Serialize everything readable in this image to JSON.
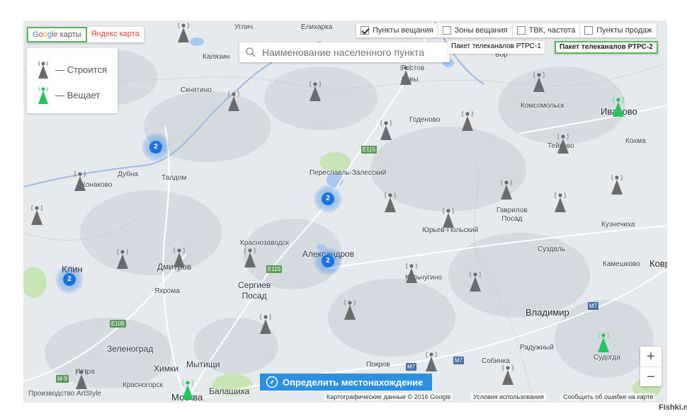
{
  "provider": {
    "google_prefix": [
      "G",
      "o",
      "o",
      "g",
      "l",
      "e"
    ],
    "google_suffix": " карты",
    "yandex": "Яндекс карта"
  },
  "legend": {
    "building": "— Строится",
    "broadcasting": "— Вещает"
  },
  "search": {
    "placeholder": "Наименование населенного пункта"
  },
  "toggles": [
    {
      "label": "Пункты вещания",
      "checked": true
    },
    {
      "label": "Зоны вещания",
      "checked": false
    },
    {
      "label": "ТВК, частота",
      "checked": false
    },
    {
      "label": "Пункты продаж",
      "checked": false
    }
  ],
  "packages": {
    "p1": "Пакет телеканалов РТРС-1",
    "p2": "Пакет телеканалов РТРС-2"
  },
  "locate_button": "Определить местонахождение",
  "zoom": {
    "in": "+",
    "out": "−"
  },
  "footer": {
    "credit": "Производство ArtStyle",
    "map_data": "Картографические данные © 2016 Google",
    "terms": "Условия использования",
    "report": "Сообщить об ошибке на карте"
  },
  "watermark": "Fishki.net",
  "colors": {
    "building": "#6b6b6b",
    "broadcasting": "#22c55e",
    "cluster": "#1d72df",
    "accent": "#2d8fe0"
  },
  "places": [
    {
      "name": "Калязин",
      "cls": ""
    },
    {
      "name": "Елихарка",
      "cls": ""
    },
    {
      "name": "Углич",
      "cls": ""
    },
    {
      "name": "Ростов",
      "cls": ""
    },
    {
      "name": "Лавы",
      "cls": ""
    },
    {
      "name": "Скнятино",
      "cls": ""
    },
    {
      "name": "Комсомольск",
      "cls": ""
    },
    {
      "name": "Иваново",
      "cls": "big"
    },
    {
      "name": "Годеново",
      "cls": ""
    },
    {
      "name": "Тейково",
      "cls": ""
    },
    {
      "name": "Кохма",
      "cls": ""
    },
    {
      "name": "Дубна",
      "cls": ""
    },
    {
      "name": "Талдом",
      "cls": ""
    },
    {
      "name": "Конаково",
      "cls": ""
    },
    {
      "name": "Переславль-Залесский",
      "cls": ""
    },
    {
      "name": "Гаврилов Посад",
      "cls": ""
    },
    {
      "name": "Юрьев-Польский",
      "cls": ""
    },
    {
      "name": "Кузнечиха",
      "cls": ""
    },
    {
      "name": "Краснозаводск",
      "cls": ""
    },
    {
      "name": "Александров",
      "cls": "med"
    },
    {
      "name": "Суздаль",
      "cls": ""
    },
    {
      "name": "Клин",
      "cls": "big"
    },
    {
      "name": "Дмитров",
      "cls": "med"
    },
    {
      "name": "Кольчугино",
      "cls": ""
    },
    {
      "name": "Камешково",
      "cls": ""
    },
    {
      "name": "Ковр",
      "cls": "big"
    },
    {
      "name": "Сергиев Посад",
      "cls": "med"
    },
    {
      "name": "Яхрома",
      "cls": ""
    },
    {
      "name": "Владимир",
      "cls": "big"
    },
    {
      "name": "Зеленоград",
      "cls": "med"
    },
    {
      "name": "Радужный",
      "cls": ""
    },
    {
      "name": "Химки",
      "cls": "med"
    },
    {
      "name": "Мытищи",
      "cls": "med"
    },
    {
      "name": "Истра",
      "cls": ""
    },
    {
      "name": "Покров",
      "cls": ""
    },
    {
      "name": "Собинка",
      "cls": ""
    },
    {
      "name": "Судогда",
      "cls": ""
    },
    {
      "name": "Красногорск",
      "cls": ""
    },
    {
      "name": "Балашиха",
      "cls": "med"
    },
    {
      "name": "Москва",
      "cls": "big"
    },
    {
      "name": "Бор",
      "cls": ""
    }
  ],
  "roads": [
    "E115",
    "E115",
    "E105",
    "M-9",
    "M7",
    "M7",
    "M7"
  ],
  "clusters": [
    "2",
    "2",
    "2",
    "2"
  ],
  "towers": [
    "building",
    "building",
    "building",
    "building",
    "building",
    "building",
    "building",
    "building",
    "building",
    "building",
    "building",
    "building",
    "building",
    "building",
    "building",
    "building",
    "building",
    "building",
    "building",
    "building",
    "building",
    "building",
    "building",
    "broadcasting",
    "broadcasting",
    "broadcasting"
  ]
}
